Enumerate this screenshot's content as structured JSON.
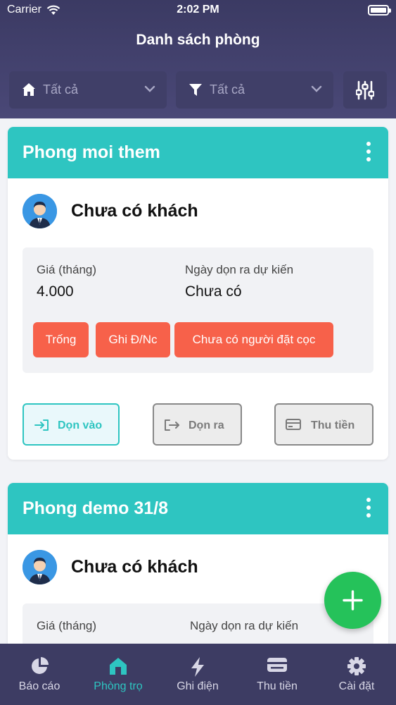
{
  "status_bar": {
    "carrier": "Carrier",
    "time": "2:02 PM"
  },
  "header": {
    "title": "Danh sách phòng"
  },
  "filters": {
    "building": {
      "value": "Tất cả",
      "icon": "home-icon"
    },
    "status": {
      "value": "Tất cả",
      "icon": "filter-icon"
    },
    "settings_icon": "sliders-icon"
  },
  "rooms": [
    {
      "name": "Phong moi them",
      "guest": "Chưa có khách",
      "price_label": "Giá (tháng)",
      "price": "4.000",
      "moveout_label": "Ngày dọn ra dự kiến",
      "moveout": "Chưa có",
      "tags": [
        "Trống",
        "Ghi Đ/Nc",
        "Chưa có người đặt cọc"
      ],
      "actions": {
        "move_in": "Dọn vào",
        "move_out": "Dọn ra",
        "collect": "Thu tiền"
      }
    },
    {
      "name": "Phong demo 31/8",
      "guest": "Chưa có khách",
      "price_label": "Giá (tháng)",
      "moveout_label": "Ngày dọn ra dự kiến"
    }
  ],
  "fab_icon": "plus-icon",
  "tabs": [
    {
      "label": "Báo cáo",
      "icon": "pie-chart-icon"
    },
    {
      "label": "Phòng trọ",
      "icon": "house-icon",
      "active": true
    },
    {
      "label": "Ghi điện",
      "icon": "lightning-icon"
    },
    {
      "label": "Thu tiền",
      "icon": "card-icon"
    },
    {
      "label": "Cài đặt",
      "icon": "gear-icon"
    }
  ],
  "colors": {
    "header": "#3b3a63",
    "card_header": "#2ec5c1",
    "tag": "#f7614a",
    "fab": "#25c25a",
    "active_tab": "#2ec5c1"
  }
}
